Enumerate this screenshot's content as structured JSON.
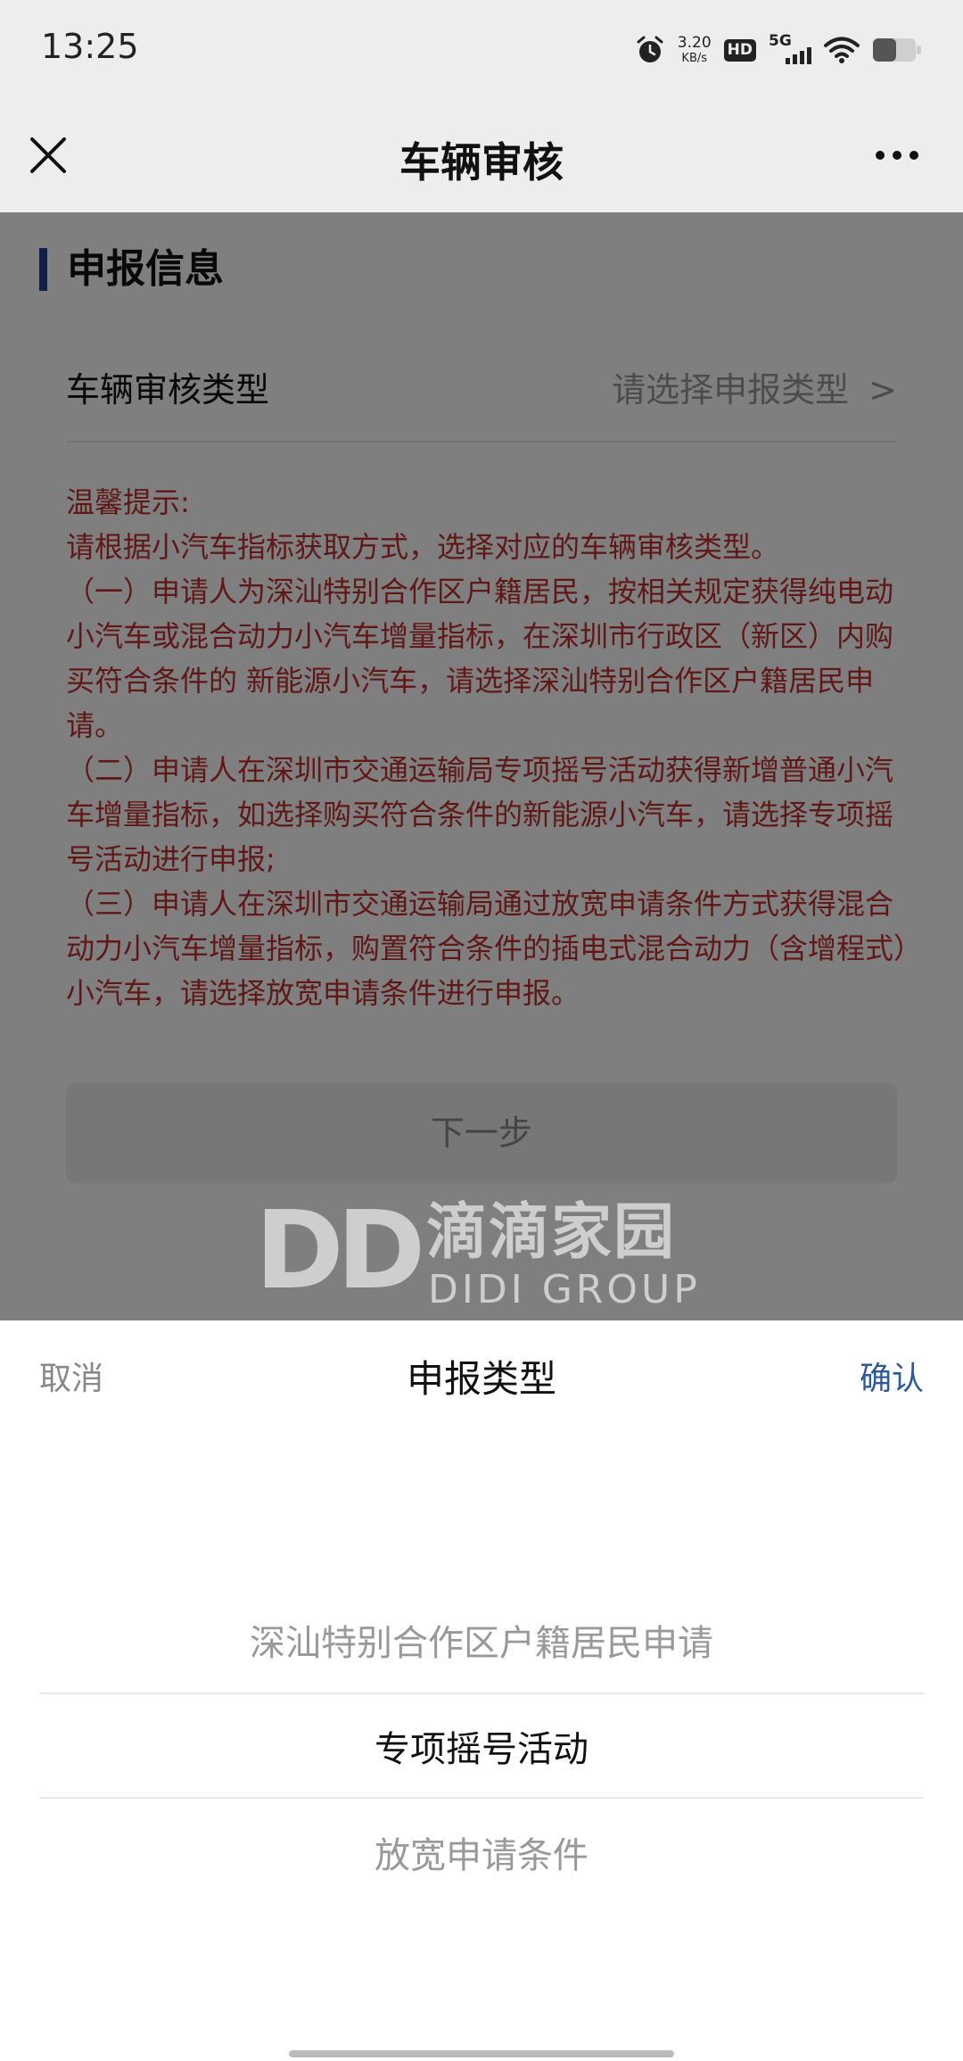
{
  "status_bar": {
    "time": "13:25",
    "net_speed_value": "3.20",
    "net_speed_unit": "KB/s",
    "hd_label": "HD",
    "network_label": "5G"
  },
  "nav": {
    "title": "车辆审核"
  },
  "form": {
    "section_title": "申报信息",
    "type_label": "车辆审核类型",
    "type_placeholder": "请选择申报类型",
    "chevron": ">",
    "tips": [
      "温馨提示:",
      "请根据小汽车指标获取方式，选择对应的车辆审核类型。",
      "（一）申请人为深汕特别合作区户籍居民，按相关规定获得纯电动小汽车或混合动力小汽车增量指标，在深圳市行政区（新区）内购买符合条件的 新能源小汽车，请选择深汕特别合作区户籍居民申请。",
      "（二）申请人在深圳市交通运输局专项摇号活动获得新增普通小汽车增量指标，如选择购买符合条件的新能源小汽车，请选择专项摇号活动进行申报;",
      "（三）申请人在深圳市交通运输局通过放宽申请条件方式获得混合动力小汽车增量指标，购置符合条件的插电式混合动力（含增程式）小汽车，请选择放宽申请条件进行申报。"
    ],
    "next_label": "下一步"
  },
  "watermark": {
    "logo_letters": "DD",
    "name_cn": "滴滴家园",
    "name_en": "DIDI GROUP"
  },
  "sheet": {
    "cancel_label": "取消",
    "title": "申报类型",
    "confirm_label": "确认",
    "options": [
      "深汕特别合作区户籍居民申请",
      "专项摇号活动",
      "放宽申请条件"
    ],
    "selected_index": 1
  },
  "colors": {
    "section_bar": "#1f3f8c",
    "tips_text": "#c0312f",
    "confirm": "#2f5a9a"
  }
}
